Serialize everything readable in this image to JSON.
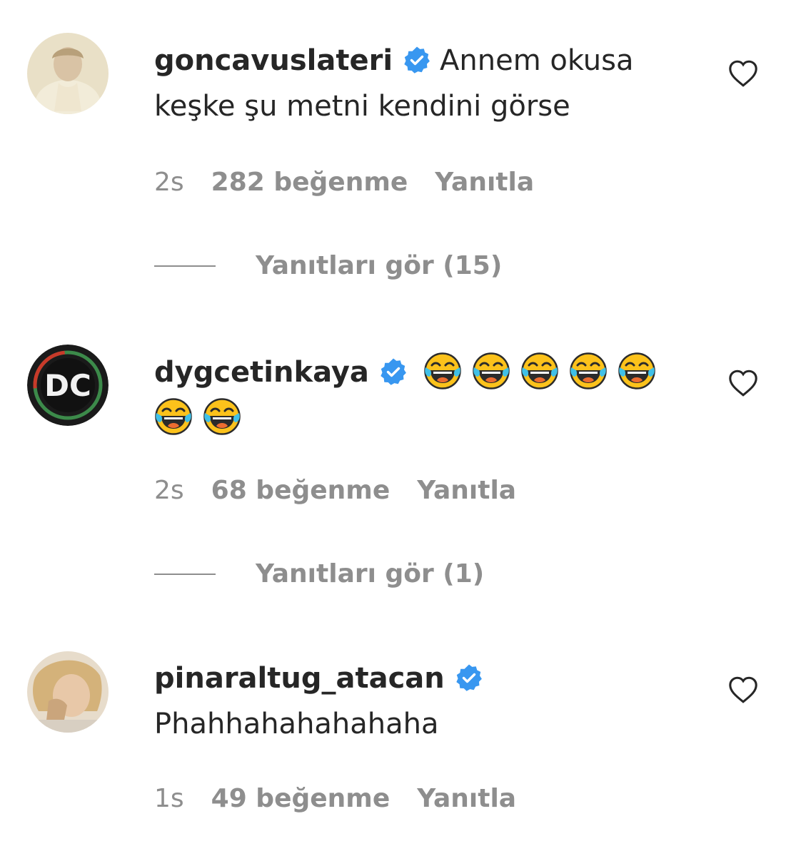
{
  "comments": [
    {
      "username": "goncavuslateri",
      "verified": true,
      "text": "Annem okusa keşke şu metni kendini görse",
      "time": "2s",
      "likes": "282 beğenme",
      "reply": "Yanıtla",
      "view_replies": "Yanıtları gör (15)"
    },
    {
      "username": "dygcetinkaya",
      "verified": true,
      "emoji": "face-with-tears-of-joy",
      "emoji_count": 7,
      "time": "2s",
      "likes": "68 beğenme",
      "reply": "Yanıtla",
      "view_replies": "Yanıtları gör (1)"
    },
    {
      "username": "pinaraltug_atacan",
      "verified": true,
      "text": "Phahhahahahahaha",
      "time": "1s",
      "likes": "49 beğenme",
      "reply": "Yanıtla"
    }
  ],
  "colors": {
    "text": "#262626",
    "muted": "#8e8e8e",
    "verified": "#3897f0"
  },
  "icons": {
    "like": "heart-outline-icon",
    "verified": "verified-badge-icon",
    "emoji": "face-with-tears-of-joy-icon"
  }
}
